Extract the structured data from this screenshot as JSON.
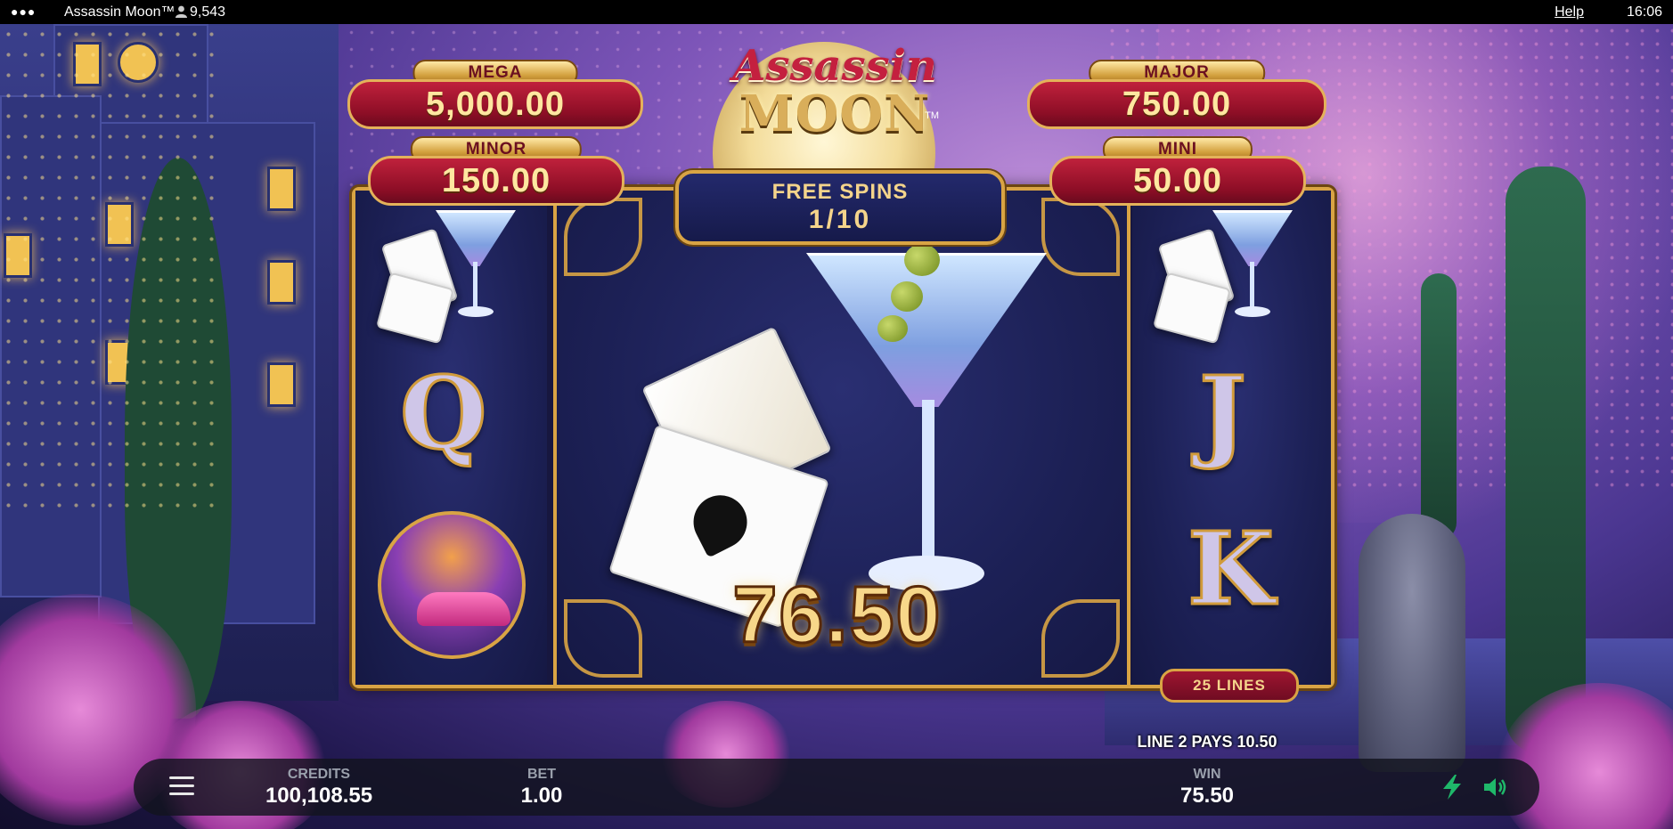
{
  "topbar": {
    "title": "Assassin Moon™",
    "player_count": "9,543",
    "help_label": "Help",
    "time": "16:06"
  },
  "jackpots": {
    "mega": {
      "label": "MEGA",
      "value": "5,000.00"
    },
    "major": {
      "label": "MAJOR",
      "value": "750.00"
    },
    "minor": {
      "label": "MINOR",
      "value": "150.00"
    },
    "mini": {
      "label": "MINI",
      "value": "50.00"
    }
  },
  "logo": {
    "line1": "Assassin",
    "line2": "MOON",
    "tm": "TM"
  },
  "free_spins": {
    "label": "FREE SPINS",
    "count": "1/10"
  },
  "reels": {
    "left": [
      "martini-cards",
      "Q",
      "car-badge"
    ],
    "center": "martini-cards-large",
    "right": [
      "martini-cards",
      "J",
      "K"
    ]
  },
  "symbols": {
    "q": "Q",
    "j": "J",
    "k": "K"
  },
  "win_amount": "76.50",
  "lines_badge": "25 LINES",
  "line_pays": "LINE 2 PAYS 10.50",
  "bottom": {
    "credits_label": "CREDITS",
    "credits_value": "100,108.55",
    "bet_label": "BET",
    "bet_value": "1.00",
    "win_label": "WIN",
    "win_value": "75.50"
  },
  "colors": {
    "gold": "#d9a444",
    "jackpot_red": "#8d0e26",
    "turbo_green": "#1fb86a"
  },
  "icons": [
    "more-icon",
    "player-icon",
    "menu-icon",
    "turbo-icon",
    "sound-icon"
  ]
}
